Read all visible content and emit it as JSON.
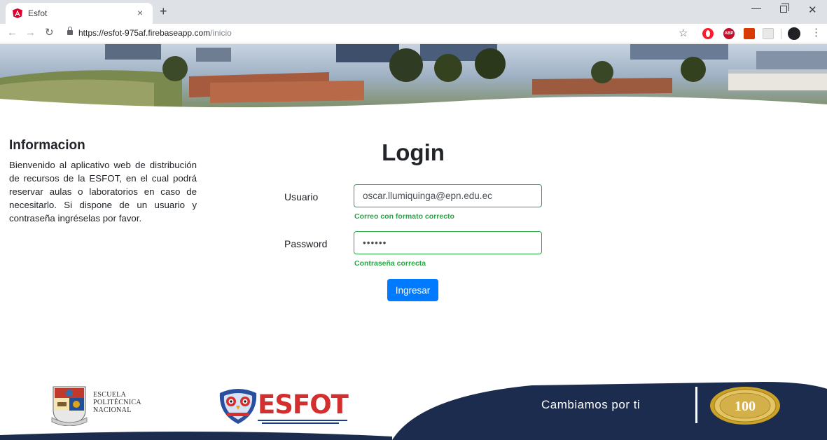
{
  "browser": {
    "tab_title": "Esfot",
    "url_host": "https://esfot-975af.firebaseapp.com",
    "url_path": "/inicio",
    "close_glyph": "×",
    "new_tab_glyph": "+",
    "abp_label": "ABP",
    "icons": [
      "angular-favicon-icon",
      "back-arrow-icon",
      "forward-arrow-icon",
      "reload-icon",
      "lock-icon",
      "star-icon",
      "opera-extension-icon",
      "adblock-plus-icon",
      "office-extension-icon",
      "acrobat-extension-icon",
      "profile-avatar",
      "menu-kebab-icon"
    ]
  },
  "info": {
    "title": "Informacion",
    "text": "Bienvenido al aplicativo web de distribución de recursos de la ESFOT, en el cual podrá reservar aulas o laboratorios en caso de necesitarlo. Si dispone de un usuario y contraseña ingréselas por favor."
  },
  "login": {
    "title": "Login",
    "user_label": "Usuario",
    "user_value": "oscar.llumiquinga@epn.edu.ec",
    "user_valid_msg": "Correo con formato correcto",
    "password_label": "Password",
    "password_value": "123456",
    "password_valid_msg": "Contraseña correcta",
    "submit_label": "Ingresar"
  },
  "footer": {
    "epn_text_1": "ESCUELA",
    "epn_text_2": "POLITÉCNICA",
    "epn_text_3": "NACIONAL",
    "esfot_word": "ESFOT",
    "slogan": "Cambiamos por ti",
    "seal_text": "100"
  },
  "colors": {
    "primary": "#007bff",
    "valid": "#28a745",
    "footer_navy": "#1b2c4f",
    "esfot_red": "#d32f2f",
    "seal_gold": "#c9a227"
  }
}
